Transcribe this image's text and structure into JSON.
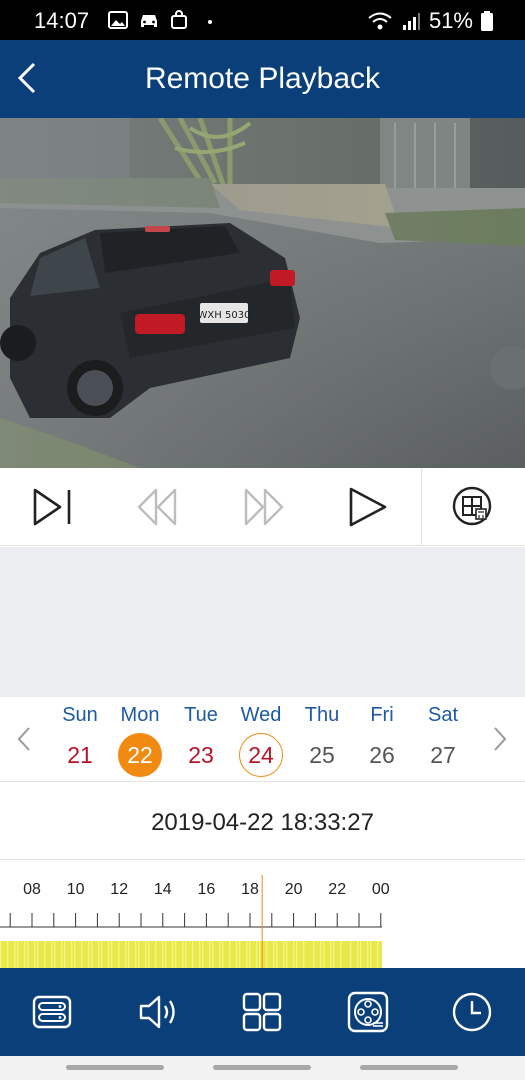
{
  "status_bar": {
    "time": "14:07",
    "battery": "51%"
  },
  "header": {
    "title": "Remote Playback"
  },
  "calendar": {
    "days": [
      {
        "name": "Sun",
        "num": "21",
        "state": "red"
      },
      {
        "name": "Mon",
        "num": "22",
        "state": "selected"
      },
      {
        "name": "Tue",
        "num": "23",
        "state": "red"
      },
      {
        "name": "Wed",
        "num": "24",
        "state": "today"
      },
      {
        "name": "Thu",
        "num": "25",
        "state": "gray"
      },
      {
        "name": "Fri",
        "num": "26",
        "state": "gray"
      },
      {
        "name": "Sat",
        "num": "27",
        "state": "gray"
      }
    ]
  },
  "playback": {
    "datetime": "2019-04-22 18:33:27"
  },
  "timeline": {
    "hour_labels": [
      "08",
      "10",
      "12",
      "14",
      "16",
      "18",
      "20",
      "22",
      "00"
    ],
    "cursor_hour": 18.56
  },
  "video": {
    "plate_text": "WXH 5030"
  },
  "colors": {
    "header_bg": "#0b3f7a",
    "accent_orange": "#f08a11",
    "recording_yellow": "#e8e84a",
    "day_red": "#b7142a",
    "day_name_blue": "#1e5aa3"
  }
}
